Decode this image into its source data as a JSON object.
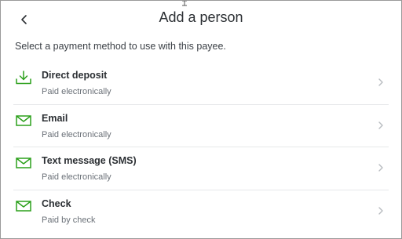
{
  "header": {
    "title": "Add a person"
  },
  "instructions": "Select a payment method to use with this payee.",
  "colors": {
    "accent": "#2ca01c",
    "divider": "#e6e8ea",
    "chevron": "#b8bcc0"
  },
  "payment_methods": [
    {
      "icon": "download-icon",
      "label": "Direct deposit",
      "description": "Paid electronically"
    },
    {
      "icon": "envelope-icon",
      "label": "Email",
      "description": "Paid electronically"
    },
    {
      "icon": "envelope-icon",
      "label": "Text message (SMS)",
      "description": "Paid electronically"
    },
    {
      "icon": "envelope-icon",
      "label": "Check",
      "description": "Paid by check"
    }
  ]
}
